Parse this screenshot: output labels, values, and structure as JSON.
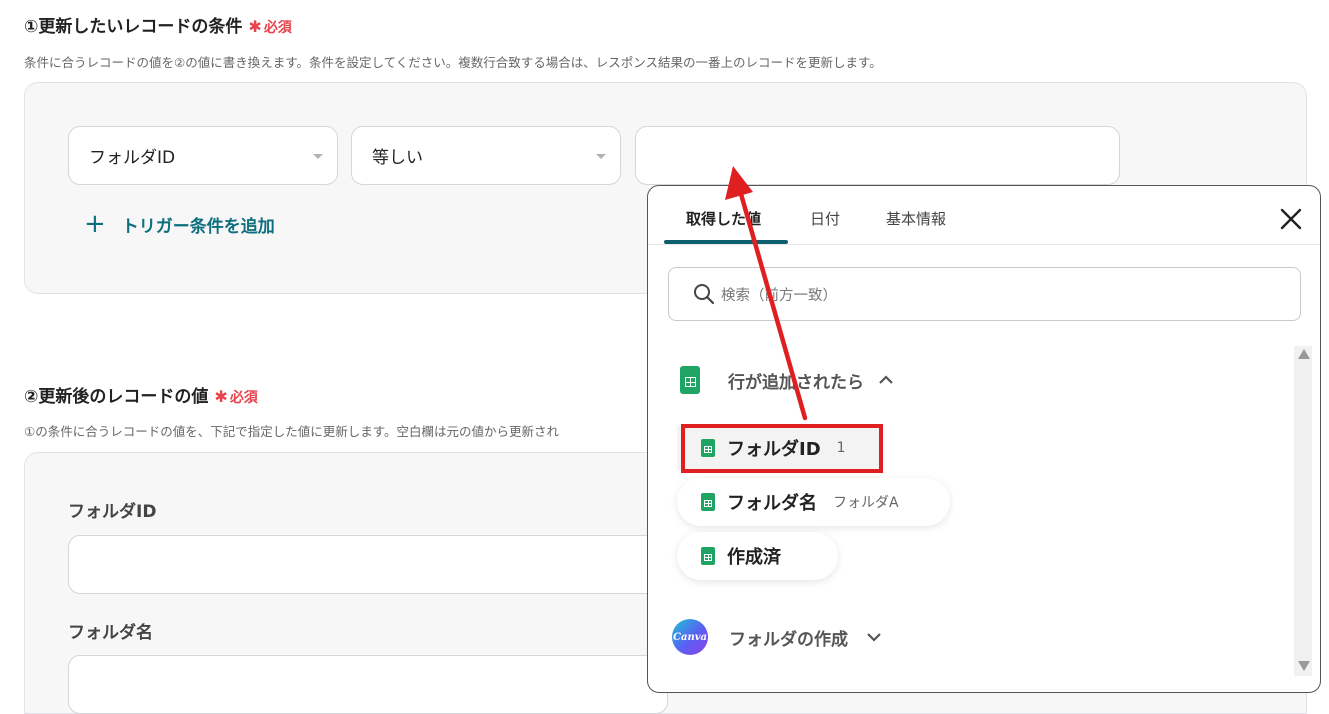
{
  "section1": {
    "title": "①更新したいレコードの条件",
    "required": "必須",
    "description": "条件に合うレコードの値を②の値に書き換えます。条件を設定してください。複数行合致する場合は、レスポンス結果の一番上のレコードを更新します。",
    "field_select": "フォルダID",
    "operator_select": "等しい",
    "value_input": "",
    "add_condition": "トリガー条件を追加"
  },
  "section2": {
    "title": "②更新後のレコードの値",
    "required": "必須",
    "description": "①の条件に合うレコードの値を、下記で指定した値に更新します。空白欄は元の値から更新され",
    "fields": [
      {
        "label": "フォルダID",
        "value": ""
      },
      {
        "label": "フォルダ名",
        "value": ""
      }
    ]
  },
  "popup": {
    "tabs": [
      "取得した値",
      "日付",
      "基本情報"
    ],
    "active_tab": 0,
    "search_placeholder": "検索（前方一致）",
    "groups": [
      {
        "name": "行が追加されたら",
        "icon": "google-sheets-icon",
        "expanded": true,
        "items": [
          {
            "name": "フォルダID",
            "value": "1",
            "highlighted": true
          },
          {
            "name": "フォルダ名",
            "value": "フォルダA"
          },
          {
            "name": "作成済",
            "value": ""
          }
        ]
      },
      {
        "name": "フォルダの作成",
        "icon": "canva-icon",
        "icon_text": "Canva",
        "expanded": false
      }
    ]
  },
  "colors": {
    "accent": "#0d6e7e",
    "required": "#e8444e",
    "annotation": "#e02020",
    "sheets_green": "#1fa463"
  }
}
